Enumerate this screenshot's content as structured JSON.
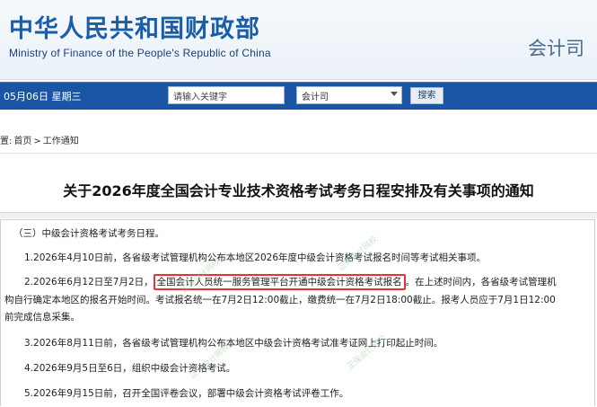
{
  "header": {
    "ministry_cn": "中华人民共和国财政部",
    "ministry_en": "Ministry of Finance of the People's Republic of China",
    "department": "会计司"
  },
  "nav": {
    "date": "05月06日 星期三",
    "search_placeholder": "请输入关键字",
    "select_value": "会计司",
    "search_button": "搜索"
  },
  "breadcrumb": {
    "prefix": "置:",
    "home": "首页",
    "sep": ">",
    "current": "工作通知"
  },
  "notice": {
    "title": "关于2026年度全国会计专业技术资格考试考务日程安排及有关事项的通知",
    "section_heading": "（三）中级会计资格考试考务日程。",
    "item1": "1.2026年4月10日前，各省级考试管理机构公布本地区2026年度中级会计资格考试报名时间等考试相关事项。",
    "item2_before": "2.2026年6月12日至7月2日，",
    "item2_highlight": "全国会计人员统一服务管理平台开通中级会计资格考试报名",
    "item2_after": "。在上述时间内，各省级考试管理机",
    "item2_line2": "构自行确定本地区的报名开始时间。考试报名统一在7月2日12:00截止，缴费统一在7月2日18:00截止。报考人员应于7月1日12:00",
    "item2_line3": "前完成信息采集。",
    "item3": "3.2026年8月11日前，各省级考试管理机构公布本地区中级会计资格考试准考证网上打印起止时间。",
    "item4": "4.2026年9月5日至6日，组织中级会计资格考试。",
    "item5": "5.2026年9月15日前，召开全国评卷会议，部署中级会计资格考试评卷工作。"
  },
  "watermark": {
    "text": "正保会计网校"
  }
}
